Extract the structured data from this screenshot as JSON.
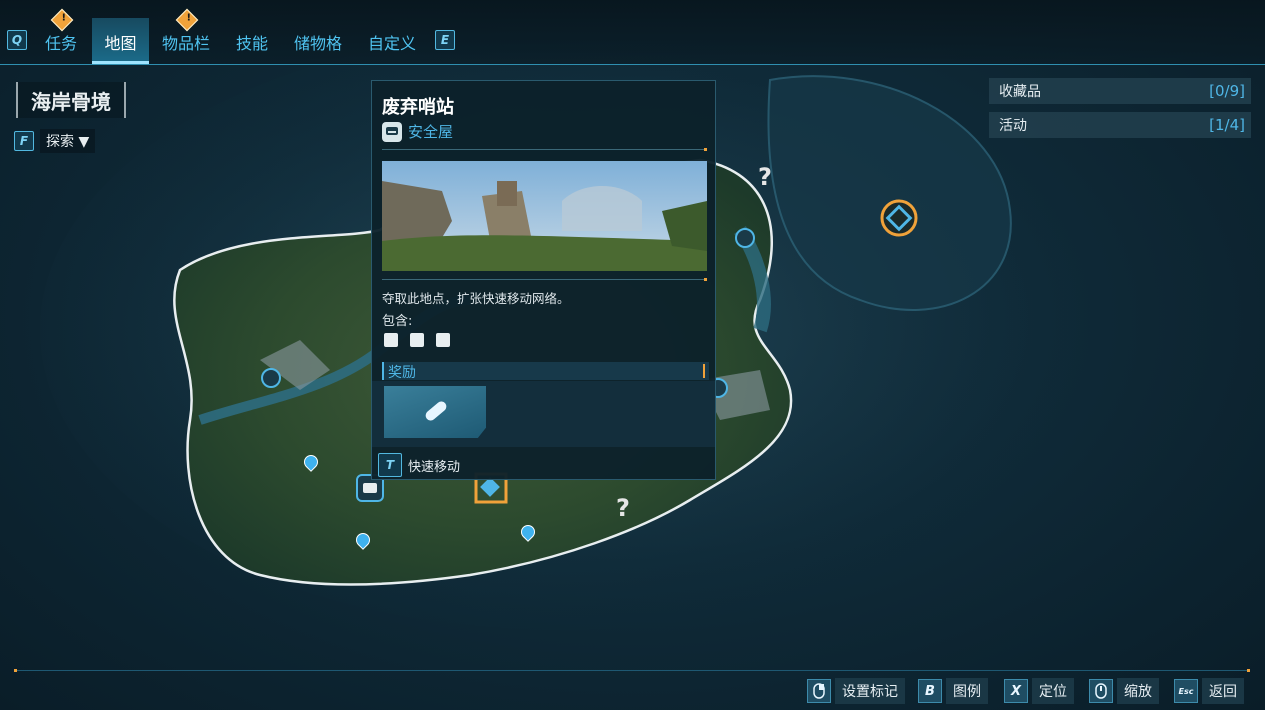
{
  "nav": {
    "left_key": "Q",
    "right_key": "E",
    "tabs": [
      {
        "label": "任务",
        "active": false,
        "alert": true
      },
      {
        "label": "地图",
        "active": true,
        "alert": false
      },
      {
        "label": "物品栏",
        "active": false,
        "alert": true
      },
      {
        "label": "技能",
        "active": false,
        "alert": false
      },
      {
        "label": "储物格",
        "active": false,
        "alert": false
      },
      {
        "label": "自定义",
        "active": false,
        "alert": false
      }
    ],
    "alert_glyph": "!"
  },
  "region": {
    "name": "海岸骨境",
    "explore_key": "F",
    "explore_label": "探索"
  },
  "tracker": [
    {
      "label": "收藏品",
      "count": "[0/9]"
    },
    {
      "label": "活动",
      "count": "[1/4]"
    }
  ],
  "location_panel": {
    "title": "废弃哨站",
    "type": "安全屋",
    "description": "夺取此地点，扩张快速移动网络。",
    "contains_label": "包含:",
    "reward_label": "奖励",
    "fast_travel_key": "T",
    "fast_travel_label": "快速移动"
  },
  "map": {
    "question_mark": "?"
  },
  "hints": [
    {
      "key": "",
      "label": "设置标记",
      "icon": "mouse-icon"
    },
    {
      "key": "B",
      "label": "图例",
      "icon": ""
    },
    {
      "key": "X",
      "label": "定位",
      "icon": ""
    },
    {
      "key": "",
      "label": "缩放",
      "icon": "scroll-icon"
    },
    {
      "key": "Esc",
      "label": "返回",
      "icon": ""
    }
  ],
  "colors": {
    "accent": "#4fb6e6",
    "alert": "#f0a23a",
    "panel_bg": "#0d212b"
  }
}
